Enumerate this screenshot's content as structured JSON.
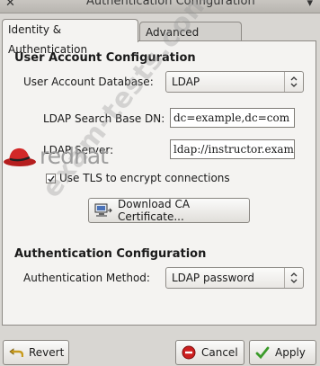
{
  "window": {
    "title": "Authentication Configuration"
  },
  "tabs": [
    {
      "label": "Identity & Authentication",
      "active": true
    },
    {
      "label": "Advanced Options",
      "active": false
    }
  ],
  "user_account": {
    "section_title": "User Account Configuration",
    "database_label": "User Account Database:",
    "database_value": "LDAP",
    "search_base_label": "LDAP Search Base DN:",
    "search_base_value": "dc=example,dc=com",
    "server_label": "LDAP Server:",
    "server_value": "ldap://instructor.examp",
    "tls_label": "Use TLS to encrypt connections",
    "tls_checked": true,
    "download_ca_label": "Download CA Certificate..."
  },
  "auth_config": {
    "section_title": "Authentication Configuration",
    "method_label": "Authentication Method:",
    "method_value": "LDAP password"
  },
  "buttons": {
    "revert": "Revert",
    "cancel": "Cancel",
    "apply": "Apply"
  },
  "overlay": {
    "watermark": "exam-tests.com",
    "logo_text": "redhat"
  },
  "colors": {
    "accent_red": "#cc1f1f",
    "apply_green": "#3b9b2a",
    "panel_bg": "#f4f3f1"
  }
}
